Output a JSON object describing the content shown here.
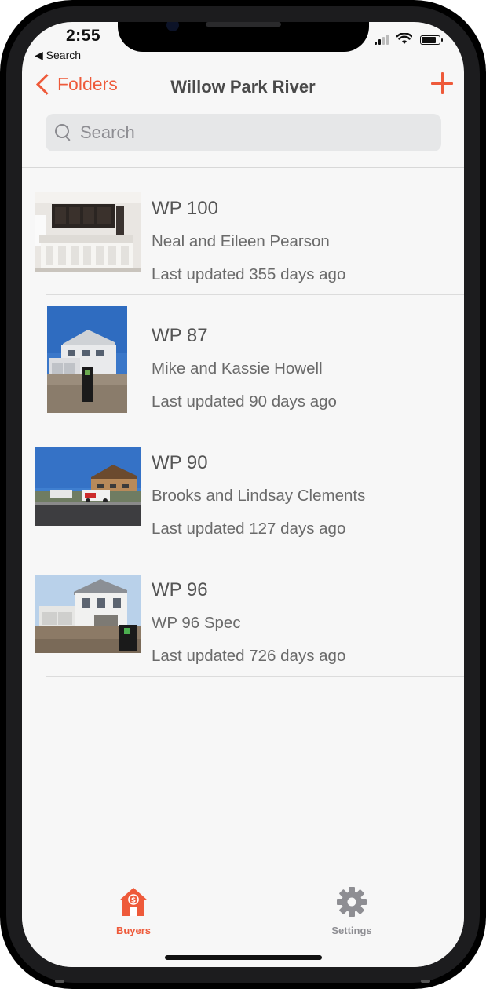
{
  "status_bar": {
    "time": "2:55",
    "back_app": "◀ Search"
  },
  "nav": {
    "back_label": "Folders",
    "title": "Willow Park River",
    "add_icon": "plus-icon"
  },
  "search": {
    "placeholder": "Search",
    "value": ""
  },
  "houses": [
    {
      "title": "WP 100",
      "owners": "Neal and Eileen Pearson",
      "updated": "Last updated 355 days ago"
    },
    {
      "title": "WP 87",
      "owners": "Mike and Kassie Howell",
      "updated": "Last updated 90 days ago"
    },
    {
      "title": "WP 90",
      "owners": "Brooks and Lindsay Clements",
      "updated": "Last updated 127 days ago"
    },
    {
      "title": "WP 96",
      "owners": "WP 96 Spec",
      "updated": "Last updated 726 days ago"
    }
  ],
  "tabbar": {
    "tabs": [
      {
        "label": "Buyers",
        "icon": "house-dollar-icon",
        "active": true
      },
      {
        "label": "Settings",
        "icon": "gear-icon",
        "active": false
      }
    ]
  },
  "colors": {
    "accent": "#ee5a3a",
    "inactive": "#8e8e93",
    "background": "#f7f7f7"
  }
}
